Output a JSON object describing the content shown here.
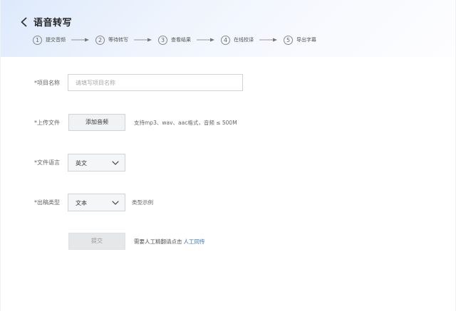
{
  "header": {
    "title": "语音转写",
    "back_icon": "chevron-left-icon"
  },
  "steps": [
    {
      "num": "1",
      "label": "提交音频"
    },
    {
      "num": "2",
      "label": "等待转写"
    },
    {
      "num": "3",
      "label": "查看结果"
    },
    {
      "num": "4",
      "label": "在线校译"
    },
    {
      "num": "5",
      "label": "导出字幕"
    }
  ],
  "form": {
    "project_name": {
      "label": "*项目名称",
      "value": "",
      "placeholder": "请填写项目名称"
    },
    "upload": {
      "label": "*上传文件",
      "button_label": "添加音频",
      "hint": "支持mp3、wav、aac格式，音频 ≤ 500M"
    },
    "language": {
      "label": "*文件语言",
      "selected": "英文"
    },
    "output_type": {
      "label": "*出稿类型",
      "selected": "文本",
      "example_hint": "类型示例"
    },
    "submit": {
      "button_label": "提交",
      "note": "需要人工精翻请点击",
      "link_label": "人工同传"
    }
  },
  "colors": {
    "link": "#2f6fd6",
    "header_gradient_start": "#dde9fb"
  }
}
